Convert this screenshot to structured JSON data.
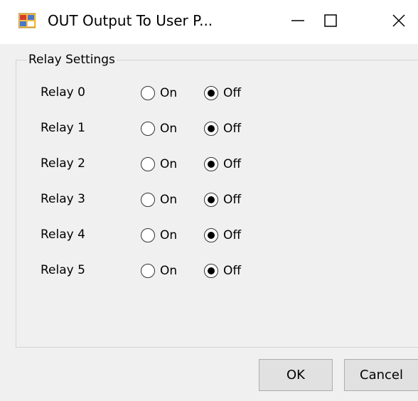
{
  "window": {
    "title": "OUT Output To User P...",
    "icon": "app-form-icon",
    "controls": {
      "minimize_icon": "minimize-icon",
      "maximize_icon": "maximize-icon",
      "close_icon": "close-icon"
    }
  },
  "group": {
    "legend": "Relay Settings"
  },
  "relays": [
    {
      "label": "Relay 0",
      "on_label": "On",
      "off_label": "Off",
      "selected": "Off"
    },
    {
      "label": "Relay 1",
      "on_label": "On",
      "off_label": "Off",
      "selected": "Off"
    },
    {
      "label": "Relay 2",
      "on_label": "On",
      "off_label": "Off",
      "selected": "Off"
    },
    {
      "label": "Relay 3",
      "on_label": "On",
      "off_label": "Off",
      "selected": "Off"
    },
    {
      "label": "Relay 4",
      "on_label": "On",
      "off_label": "Off",
      "selected": "Off"
    },
    {
      "label": "Relay 5",
      "on_label": "On",
      "off_label": "Off",
      "selected": "Off"
    }
  ],
  "buttons": {
    "ok_label": "OK",
    "cancel_label": "Cancel"
  },
  "colors": {
    "titlebar": "#ffffff",
    "client_background": "#f0f0f0",
    "button_face": "#e1e1e1",
    "button_border": "#adadad"
  }
}
